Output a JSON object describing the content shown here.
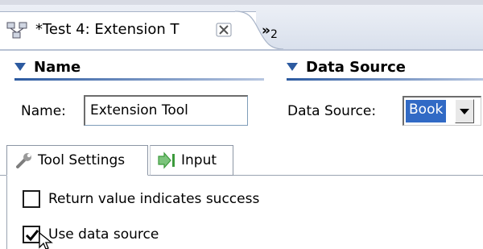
{
  "editor_tab": {
    "title": "*Test 4: Extension T",
    "icon": "tool-test-icon",
    "close_icon": "close-icon"
  },
  "overflow_tabs": {
    "chevron": "»",
    "count": "2"
  },
  "sections": {
    "name": {
      "title": "Name",
      "label": "Name:",
      "value": "Extension Tool"
    },
    "data_source": {
      "title": "Data Source",
      "label": "Data Source:",
      "selected": "Book"
    }
  },
  "inner_tabs": [
    {
      "label": "Tool Settings",
      "icon": "wrench-icon",
      "active": true
    },
    {
      "label": "Input",
      "icon": "input-arrow-icon",
      "active": false
    }
  ],
  "options": [
    {
      "label": "Return value indicates success",
      "checked": false
    },
    {
      "label": "Use data source",
      "checked": true
    }
  ],
  "colors": {
    "section_rule": "#2c5aa0",
    "selection": "#316ac5",
    "input_icon": "#3c9a3c"
  }
}
